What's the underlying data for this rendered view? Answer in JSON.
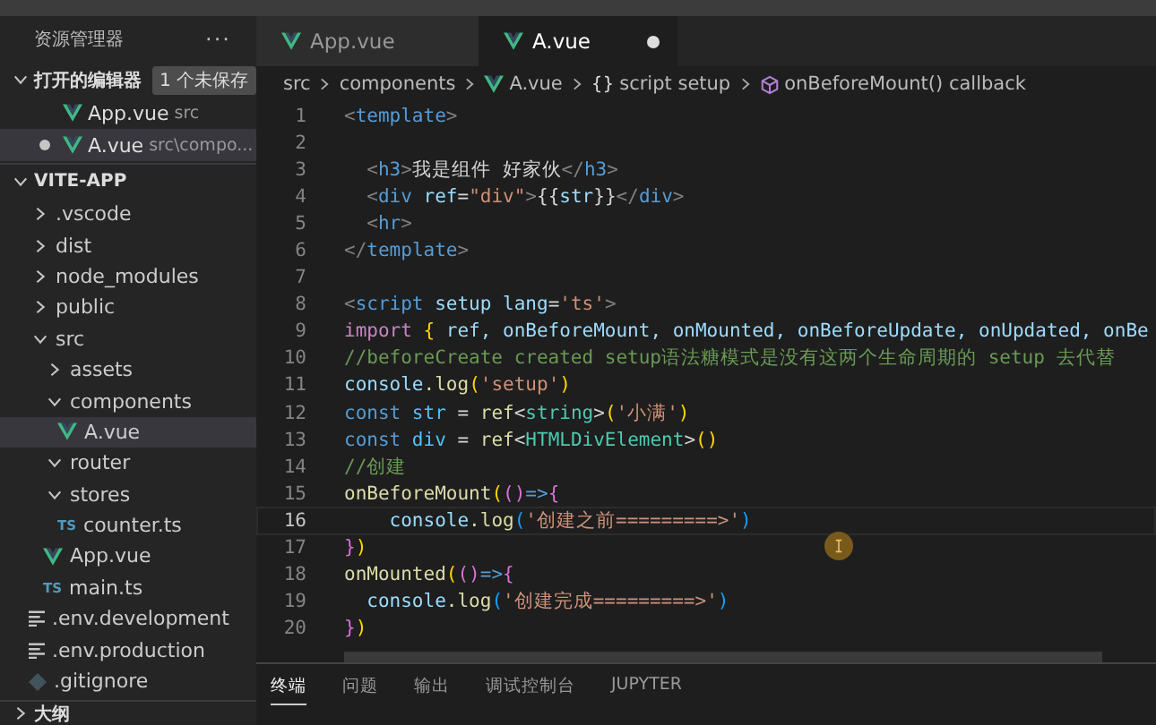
{
  "sidebar": {
    "title": "资源管理器",
    "more": "···",
    "open_editors": {
      "title": "打开的编辑器",
      "badge": "1 个未保存",
      "expanded": true,
      "items": [
        {
          "kind": "vue",
          "name": "App.vue",
          "path": "src",
          "unsaved": false,
          "selected": false
        },
        {
          "kind": "vue",
          "name": "A.vue",
          "path": "src\\compo...",
          "unsaved": true,
          "selected": true
        }
      ]
    },
    "project": {
      "title": "VITE-APP",
      "expanded": true,
      "tree": [
        {
          "kind": "folder",
          "name": ".vscode",
          "expanded": false,
          "selected": false
        },
        {
          "kind": "folder",
          "name": "dist",
          "expanded": false,
          "selected": false
        },
        {
          "kind": "folder",
          "name": "node_modules",
          "expanded": false,
          "selected": false
        },
        {
          "kind": "folder",
          "name": "public",
          "expanded": false,
          "selected": false
        },
        {
          "kind": "folder",
          "name": "src",
          "expanded": true,
          "selected": false,
          "children": [
            {
              "kind": "folder",
              "name": "assets",
              "expanded": false,
              "selected": false
            },
            {
              "kind": "folder",
              "name": "components",
              "expanded": true,
              "selected": false,
              "children": [
                {
                  "kind": "vue",
                  "name": "A.vue",
                  "selected": true
                }
              ]
            },
            {
              "kind": "folder",
              "name": "router",
              "expanded": true,
              "selected": false
            },
            {
              "kind": "folder",
              "name": "stores",
              "expanded": true,
              "selected": false,
              "children": [
                {
                  "kind": "ts",
                  "type_label": "TS",
                  "name": "counter.ts",
                  "selected": false
                }
              ]
            },
            {
              "kind": "vue",
              "name": "App.vue",
              "selected": false
            },
            {
              "kind": "ts",
              "type_label": "TS",
              "name": "main.ts",
              "selected": false
            }
          ]
        },
        {
          "kind": "env",
          "name": ".env.development",
          "selected": false
        },
        {
          "kind": "env",
          "name": ".env.production",
          "selected": false
        },
        {
          "kind": "git",
          "name": ".gitignore",
          "selected": false
        }
      ]
    },
    "outline": {
      "title": "大纲",
      "expanded": false
    }
  },
  "tabs": [
    {
      "kind": "vue",
      "label": "App.vue",
      "selected": false,
      "unsaved": false
    },
    {
      "kind": "vue",
      "label": "A.vue",
      "selected": true,
      "unsaved": true
    }
  ],
  "breadcrumb": [
    {
      "kind": "folder",
      "label": "src"
    },
    {
      "kind": "folder",
      "label": "components"
    },
    {
      "kind": "vue",
      "label": "A.vue"
    },
    {
      "kind": "braces",
      "symbol": "{}",
      "label": "script setup"
    },
    {
      "kind": "method",
      "label": "onBeforeMount() callback"
    }
  ],
  "code": [
    {
      "n": "1",
      "current": false,
      "tokens": [
        {
          "kind": "punct",
          "text": "<"
        },
        {
          "kind": "tag",
          "text": "template"
        },
        {
          "kind": "punct",
          "text": ">"
        }
      ]
    },
    {
      "n": "2",
      "current": false
    },
    {
      "n": "3",
      "current": false,
      "tokens": [
        {
          "kind": "punct",
          "text": "  <"
        },
        {
          "kind": "tag",
          "text": "h3"
        },
        {
          "kind": "punct",
          "text": ">"
        },
        {
          "kind": "plain",
          "text": "我是组件 好家伙"
        },
        {
          "kind": "punct",
          "text": "</"
        },
        {
          "kind": "tag",
          "text": "h3"
        },
        {
          "kind": "punct",
          "text": ">"
        }
      ]
    },
    {
      "n": "4",
      "current": false,
      "tokens": [
        {
          "kind": "punct",
          "text": "  <"
        },
        {
          "kind": "tag",
          "text": "div"
        },
        {
          "kind": "attr",
          "text": " ref"
        },
        {
          "kind": "plain",
          "text": "="
        },
        {
          "kind": "string",
          "text": "\"div\""
        },
        {
          "kind": "punct",
          "text": ">"
        },
        {
          "kind": "plain",
          "text": "{{"
        },
        {
          "kind": "attr",
          "text": "str"
        },
        {
          "kind": "plain",
          "text": "}}"
        },
        {
          "kind": "punct",
          "text": "</"
        },
        {
          "kind": "tag",
          "text": "div"
        },
        {
          "kind": "punct",
          "text": ">"
        }
      ]
    },
    {
      "n": "5",
      "current": false,
      "tokens": [
        {
          "kind": "punct",
          "text": "  <"
        },
        {
          "kind": "tag",
          "text": "hr"
        },
        {
          "kind": "punct",
          "text": ">"
        }
      ]
    },
    {
      "n": "6",
      "current": false,
      "tokens": [
        {
          "kind": "punct",
          "text": "</"
        },
        {
          "kind": "tag",
          "text": "template"
        },
        {
          "kind": "punct",
          "text": ">"
        }
      ]
    },
    {
      "n": "7",
      "current": false
    },
    {
      "n": "8",
      "current": false,
      "tokens": [
        {
          "kind": "punct",
          "text": "<"
        },
        {
          "kind": "tag",
          "text": "script"
        },
        {
          "kind": "attr",
          "text": " setup lang"
        },
        {
          "kind": "plain",
          "text": "="
        },
        {
          "kind": "string",
          "text": "'ts'"
        },
        {
          "kind": "punct",
          "text": ">"
        }
      ]
    },
    {
      "n": "9",
      "current": false,
      "tokens": [
        {
          "kind": "keyword",
          "text": "import"
        },
        {
          "kind": "bracket",
          "text": " { "
        },
        {
          "kind": "attr",
          "text": "ref, onBeforeMount, onMounted, onBeforeUpdate, onUpdated, onBe"
        }
      ]
    },
    {
      "n": "10",
      "current": false,
      "tokens": [
        {
          "kind": "comment",
          "text": "//beforeCreate created setup语法糖模式是没有这两个生命周期的 setup 去代替"
        }
      ]
    },
    {
      "n": "11",
      "current": false,
      "tokens": [
        {
          "kind": "attr",
          "text": "console"
        },
        {
          "kind": "func",
          "text": ".log"
        },
        {
          "kind": "bracket",
          "text": "("
        },
        {
          "kind": "string",
          "text": "'setup'"
        },
        {
          "kind": "bracket",
          "text": ")"
        }
      ]
    },
    {
      "n": "12",
      "current": false,
      "tokens": [
        {
          "kind": "const",
          "text": "const"
        },
        {
          "kind": "var",
          "text": " str "
        },
        {
          "kind": "plain",
          "text": "= "
        },
        {
          "kind": "func",
          "text": "ref"
        },
        {
          "kind": "plain",
          "text": "<"
        },
        {
          "kind": "type",
          "text": "string"
        },
        {
          "kind": "plain",
          "text": ">"
        },
        {
          "kind": "bracket",
          "text": "("
        },
        {
          "kind": "string",
          "text": "'小满'"
        },
        {
          "kind": "bracket",
          "text": ")"
        }
      ]
    },
    {
      "n": "13",
      "current": false,
      "tokens": [
        {
          "kind": "const",
          "text": "const"
        },
        {
          "kind": "var",
          "text": " div "
        },
        {
          "kind": "plain",
          "text": "= "
        },
        {
          "kind": "func",
          "text": "ref"
        },
        {
          "kind": "plain",
          "text": "<"
        },
        {
          "kind": "type",
          "text": "HTMLDivElement"
        },
        {
          "kind": "plain",
          "text": ">"
        },
        {
          "kind": "bracket",
          "text": "()"
        }
      ]
    },
    {
      "n": "14",
      "current": false,
      "tokens": [
        {
          "kind": "comment",
          "text": "//创建"
        }
      ]
    },
    {
      "n": "15",
      "current": false,
      "tokens": [
        {
          "kind": "func",
          "text": "onBeforeMount"
        },
        {
          "kind": "bracket",
          "text": "("
        },
        {
          "kind": "bracket2",
          "text": "()"
        },
        {
          "kind": "const",
          "text": "=>"
        },
        {
          "kind": "bracket2",
          "text": "{"
        }
      ]
    },
    {
      "n": "16",
      "current": true,
      "tokens": [
        {
          "kind": "attr",
          "text": "    console"
        },
        {
          "kind": "func",
          "text": ".log"
        },
        {
          "kind": "bracket3",
          "text": "("
        },
        {
          "kind": "string",
          "text": "'创建之前=========>'"
        },
        {
          "kind": "bracket3",
          "text": ")"
        }
      ]
    },
    {
      "n": "17",
      "current": false,
      "tokens": [
        {
          "kind": "bracket2",
          "text": "}"
        },
        {
          "kind": "bracket",
          "text": ")"
        }
      ]
    },
    {
      "n": "18",
      "current": false,
      "tokens": [
        {
          "kind": "func",
          "text": "onMounted"
        },
        {
          "kind": "bracket",
          "text": "("
        },
        {
          "kind": "bracket2",
          "text": "()"
        },
        {
          "kind": "const",
          "text": "=>"
        },
        {
          "kind": "bracket2",
          "text": "{"
        }
      ]
    },
    {
      "n": "19",
      "current": false,
      "tokens": [
        {
          "kind": "attr",
          "text": "  console"
        },
        {
          "kind": "func",
          "text": ".log"
        },
        {
          "kind": "bracket3",
          "text": "("
        },
        {
          "kind": "string",
          "text": "'创建完成=========>'"
        },
        {
          "kind": "bracket3",
          "text": ")"
        }
      ]
    },
    {
      "n": "20",
      "current": false,
      "tokens": [
        {
          "kind": "bracket2",
          "text": "}"
        },
        {
          "kind": "bracket",
          "text": ")"
        }
      ]
    }
  ],
  "panel_tabs": [
    {
      "label": "终端",
      "selected": true
    },
    {
      "label": "问题",
      "selected": false
    },
    {
      "label": "输出",
      "selected": false
    },
    {
      "label": "调试控制台",
      "selected": false
    },
    {
      "label": "JUPYTER",
      "selected": false
    }
  ]
}
